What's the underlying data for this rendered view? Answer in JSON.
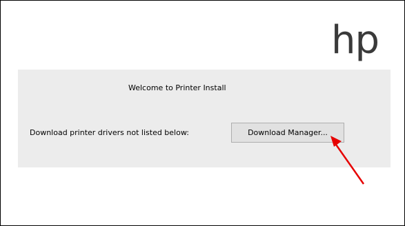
{
  "logo": {
    "text": "hp"
  },
  "panel": {
    "welcome_text": "Welcome to Printer Install",
    "download_label": "Download printer drivers not listed below:",
    "download_button_label": "Download Manager..."
  },
  "annotation": {
    "arrow_color": "#e60000"
  }
}
